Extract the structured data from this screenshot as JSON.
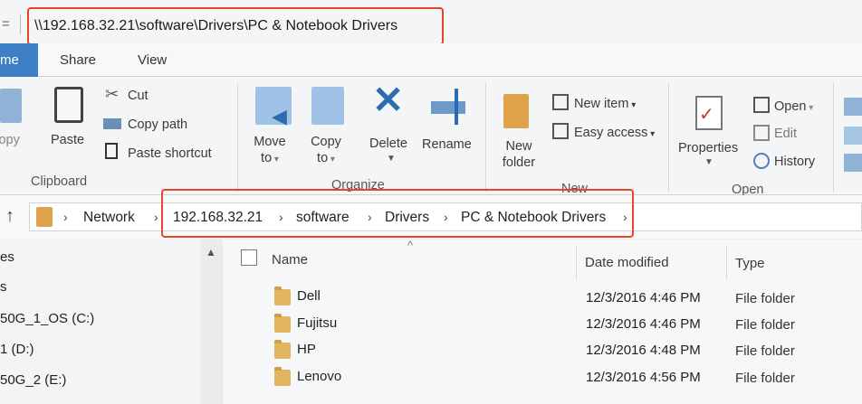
{
  "window": {
    "path_title": "\\\\192.168.32.21\\software\\Drivers\\PC & Notebook Drivers"
  },
  "tabs": {
    "home": "me",
    "share": "Share",
    "view": "View"
  },
  "ribbon": {
    "clipboard": {
      "copy": "Copy",
      "paste": "Paste",
      "cut": "Cut",
      "copy_path": "Copy path",
      "paste_shortcut": "Paste shortcut",
      "group": "Clipboard"
    },
    "organize": {
      "move_to_1": "Move",
      "move_to_2": "to",
      "copy_to_1": "Copy",
      "copy_to_2": "to",
      "delete": "Delete",
      "rename": "Rename",
      "group": "Organize"
    },
    "new": {
      "new_folder_1": "New",
      "new_folder_2": "folder",
      "new_item": "New item",
      "easy_access": "Easy access",
      "group": "New"
    },
    "open": {
      "properties": "Properties",
      "open": "Open",
      "edit": "Edit",
      "history": "History",
      "group": "Open"
    }
  },
  "address": {
    "root": "Network",
    "crumbs": [
      "192.168.32.21",
      "software",
      "Drivers",
      "PC & Notebook Drivers"
    ]
  },
  "nav": [
    "es",
    "s",
    "50G_1_OS (C:)",
    "1 (D:)",
    "50G_2 (E:)"
  ],
  "columns": {
    "name": "Name",
    "date": "Date modified",
    "type": "Type"
  },
  "files": [
    {
      "name": "Dell",
      "date": "12/3/2016 4:46 PM",
      "type": "File folder"
    },
    {
      "name": "Fujitsu",
      "date": "12/3/2016 4:46 PM",
      "type": "File folder"
    },
    {
      "name": "HP",
      "date": "12/3/2016 4:48 PM",
      "type": "File folder"
    },
    {
      "name": "Lenovo",
      "date": "12/3/2016 4:56 PM",
      "type": "File folder"
    }
  ],
  "colors": {
    "accent": "#3c7fc4",
    "highlight": "#e8452f",
    "folder": "#e2b560"
  }
}
